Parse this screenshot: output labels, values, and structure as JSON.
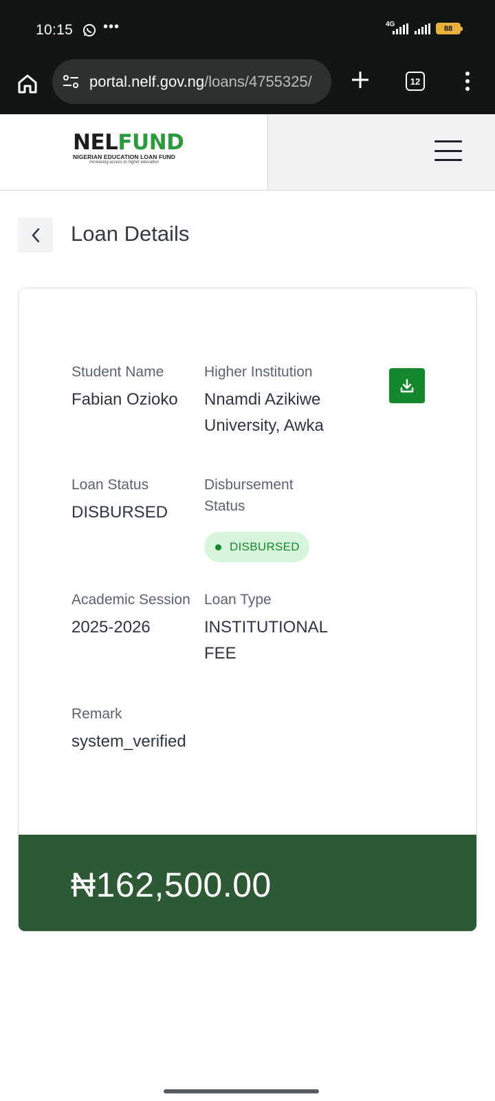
{
  "status_bar": {
    "time": "10:15",
    "network": "4G",
    "battery": "88"
  },
  "browser": {
    "url_host": "portal.nelf.gov.ng",
    "url_path": "/loans/4755325/",
    "tab_count": "12"
  },
  "site": {
    "logo_nel": "NEL",
    "logo_fund": "FUND",
    "logo_subtitle": "NIGERIAN EDUCATION LOAN FUND",
    "logo_tagline": "Increasing access to higher education"
  },
  "page": {
    "title": "Loan Details"
  },
  "loan": {
    "student_name_label": "Student Name",
    "student_name": "Fabian Ozioko",
    "institution_label": "Higher Institution",
    "institution_line1": "Nnamdi Azikiwe",
    "institution_line2": "University, Awka",
    "loan_status_label": "Loan Status",
    "loan_status": "DISBURSED",
    "disbursement_label_line1": "Disbursement",
    "disbursement_label_line2": "Status",
    "disbursement_status": "DISBURSED",
    "session_label": "Academic Session",
    "session": "2025-2026",
    "loan_type_label": "Loan Type",
    "loan_type_line1": "INSTITUTIONAL",
    "loan_type_line2": "FEE",
    "remark_label": "Remark",
    "remark": "system_verified",
    "amount": "₦162,500.00"
  },
  "colors": {
    "brand_green": "#2c9a3c",
    "button_green": "#13882c",
    "amount_bar": "#2d5a35",
    "badge_bg": "#d7f5da"
  }
}
